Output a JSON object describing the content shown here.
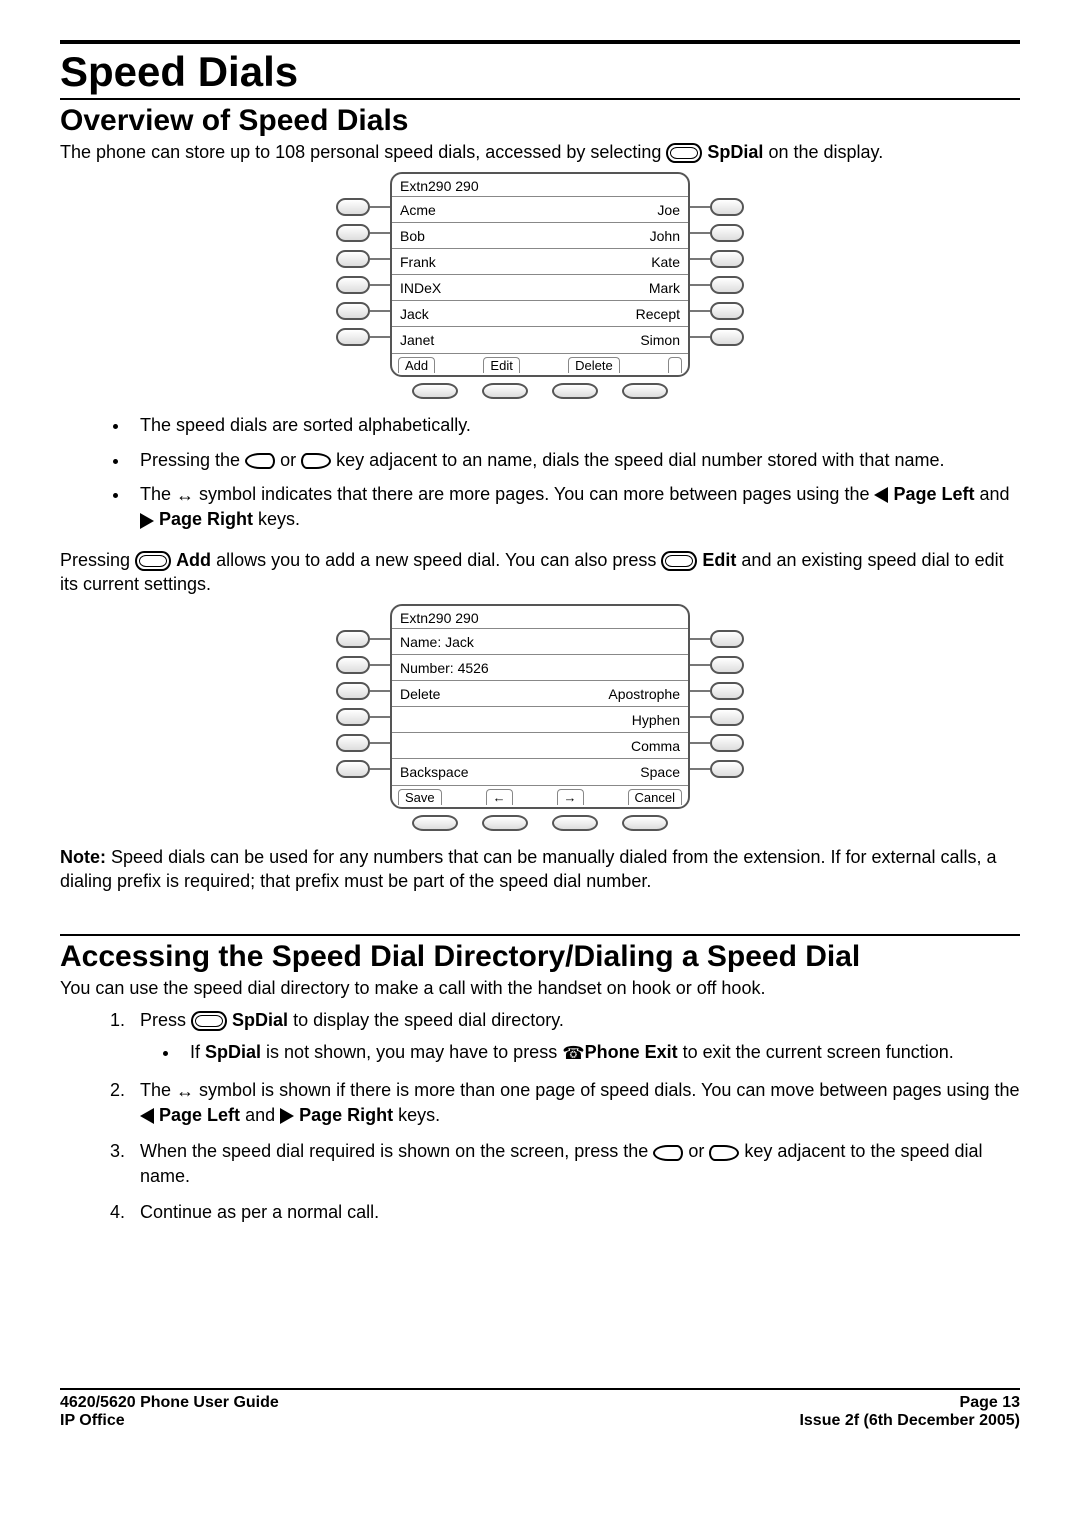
{
  "title": "Speed Dials",
  "section1": {
    "heading": "Overview of Speed Dials",
    "intro_a": "The phone can store up to 108 personal speed dials, accessed by selecting ",
    "intro_b": " SpDial",
    "intro_c": " on the display.",
    "bullet1": "The speed dials are sorted alphabetically.",
    "bullet2_a": "Pressing the ",
    "bullet2_b": " or ",
    "bullet2_c": " key adjacent to an name, dials the speed dial number stored with that name.",
    "bullet3_a": "The ",
    "bullet3_sym": "↔",
    "bullet3_b": " symbol indicates that there are more pages. You can more between pages using the ",
    "bullet3_c": "Page Left",
    "bullet3_d": " and ",
    "bullet3_e": " Page Right",
    "bullet3_f": " keys.",
    "para2_a": "Pressing ",
    "para2_b": " Add",
    "para2_c": " allows you to add a new speed dial. You can also press ",
    "para2_d": " Edit",
    "para2_e": " and an existing speed dial to edit its current settings.",
    "note_label": "Note:",
    "note_text": " Speed dials can be used for any numbers that can be manually dialed from the extension. If for external calls, a dialing prefix is required; that prefix must be part of the speed dial number."
  },
  "lcd1": {
    "header": "Extn290 290",
    "rows": [
      {
        "left": "Acme",
        "right": "Joe"
      },
      {
        "left": "Bob",
        "right": "John"
      },
      {
        "left": "Frank",
        "right": "Kate"
      },
      {
        "left": "INDeX",
        "right": "Mark"
      },
      {
        "left": "Jack",
        "right": "Recept"
      },
      {
        "left": "Janet",
        "right": "Simon"
      }
    ],
    "softkeys": [
      "Add",
      "Edit",
      "Delete",
      ""
    ]
  },
  "lcd2": {
    "header": "Extn290 290",
    "rows": [
      {
        "left": "Name: Jack",
        "right": ""
      },
      {
        "left": "Number: 4526",
        "right": ""
      },
      {
        "left": "Delete",
        "right": "Apostrophe"
      },
      {
        "left": "",
        "right": "Hyphen"
      },
      {
        "left": "",
        "right": "Comma"
      },
      {
        "left": "Backspace",
        "right": "Space"
      }
    ],
    "softkeys": [
      "Save",
      "←",
      "→",
      "Cancel"
    ]
  },
  "section2": {
    "heading": "Accessing the Speed Dial Directory/Dialing a Speed Dial",
    "intro": "You can use the speed dial directory to make a call with the handset on hook or off hook.",
    "step1_a": "Press ",
    "step1_b": " SpDial",
    "step1_c": " to display the speed dial directory.",
    "step1_sub_a": "If ",
    "step1_sub_b": "SpDial",
    "step1_sub_c": " is not shown, you may have to press ",
    "step1_sub_d": "Phone Exit",
    "step1_sub_e": " to exit the current screen function.",
    "step2_a": "The ",
    "step2_sym": "↔",
    "step2_b": " symbol is shown if there is more than one page of speed dials. You can move between pages using the ",
    "step2_c": " Page Left",
    "step2_d": " and ",
    "step2_e": " Page Right",
    "step2_f": " keys.",
    "step3_a": "When the speed dial required is shown on the screen, press the ",
    "step3_b": " or ",
    "step3_c": " key adjacent to the speed dial name.",
    "step4": "Continue as per a normal call."
  },
  "footer": {
    "left1": "4620/5620 Phone User Guide",
    "left2": "IP Office",
    "right1": "Page 13",
    "right2": "Issue 2f (6th December 2005)"
  }
}
